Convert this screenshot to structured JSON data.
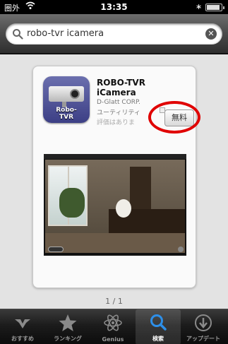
{
  "status_bar": {
    "carrier": "圏外",
    "time": "13:35",
    "bluetooth": "∗"
  },
  "search": {
    "query": "robo-tvr icamera",
    "clear_symbol": "✕"
  },
  "result": {
    "app_name_line1": "ROBO-TVR",
    "app_name_line2": "iCamera",
    "developer": "D-Glatt CORP.",
    "category": "ユーティリティ",
    "rating": "評価はありま",
    "price_label": "無料",
    "icon_logo_line1": "Robo-",
    "icon_logo_line2": "TVR",
    "highlight_color": "#e00000"
  },
  "page_indicator": "1 / 1",
  "tab_bar": {
    "active_tab": "search",
    "tabs": [
      {
        "id": "featured",
        "label": "おすすめ",
        "icon": "featured-icon"
      },
      {
        "id": "ranking",
        "label": "ランキング",
        "icon": "star-icon"
      },
      {
        "id": "genius",
        "label": "Genius",
        "icon": "genius-atom-icon"
      },
      {
        "id": "search",
        "label": "検索",
        "icon": "search-icon"
      },
      {
        "id": "updates",
        "label": "アップデート",
        "icon": "download-arrow-icon"
      }
    ]
  },
  "colors": {
    "active_tab_label": "#ffffff",
    "inactive_tab_label": "#9b9b9b"
  }
}
